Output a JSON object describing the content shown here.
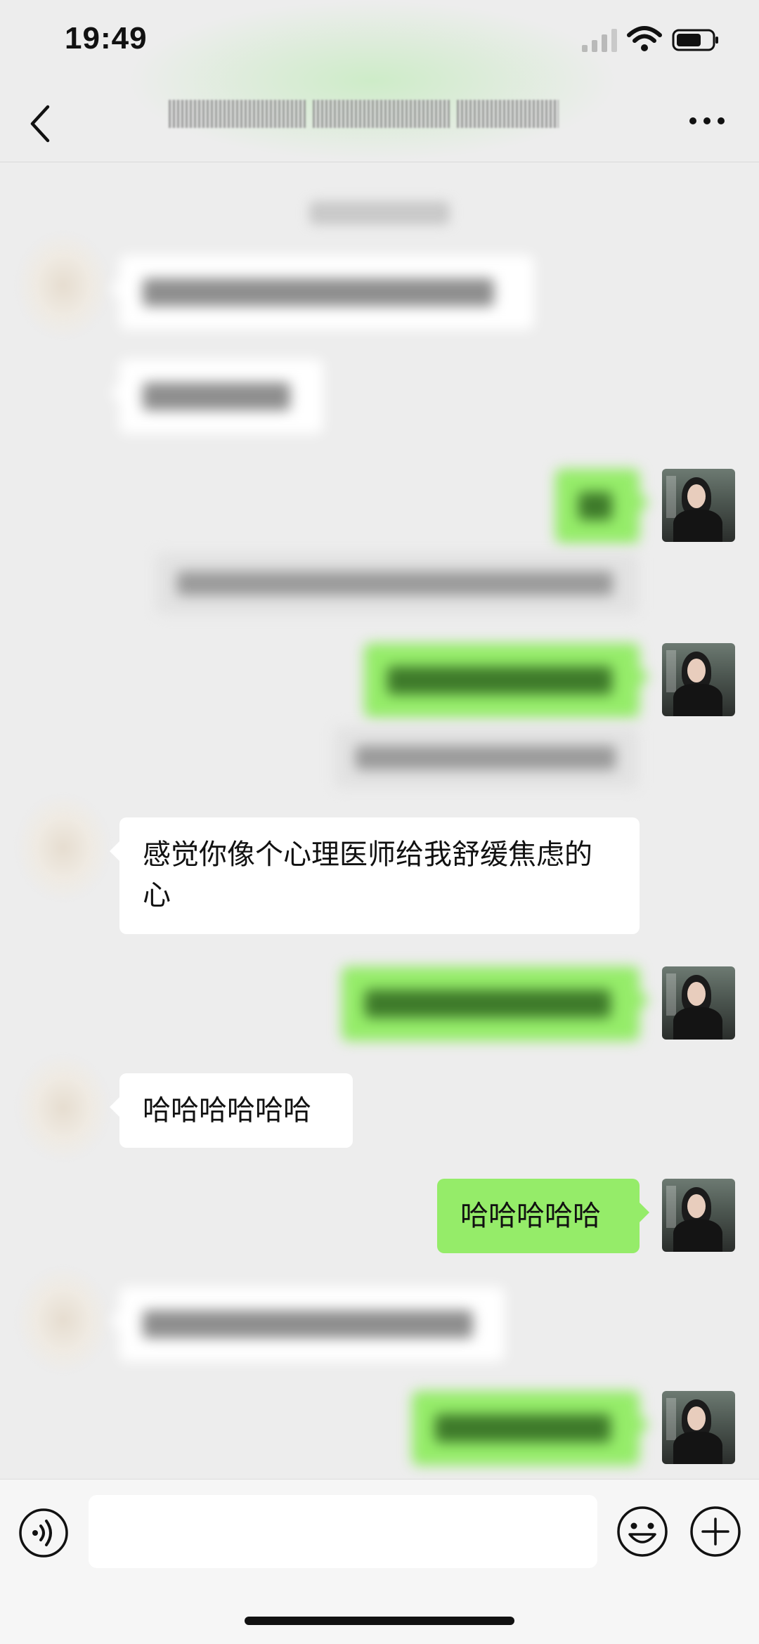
{
  "status_bar": {
    "time": "19:49"
  },
  "nav": {
    "title": "",
    "back_icon": "chevron-left-icon",
    "more_icon": "ellipsis-icon"
  },
  "messages": [
    {
      "side": "in",
      "blurred": true,
      "text": ""
    },
    {
      "side": "in",
      "blurred": true,
      "text": ""
    },
    {
      "side": "out",
      "blurred": true,
      "text": ""
    },
    {
      "side": "quote",
      "blurred": true,
      "text": ""
    },
    {
      "side": "out",
      "blurred": true,
      "text": ""
    },
    {
      "side": "quote",
      "blurred": true,
      "text": ""
    },
    {
      "side": "in",
      "blurred": false,
      "text": "感觉你像个心理医师给我舒缓焦虑的心"
    },
    {
      "side": "out",
      "blurred": true,
      "text": ""
    },
    {
      "side": "in",
      "blurred": false,
      "text": "哈哈哈哈哈哈"
    },
    {
      "side": "out",
      "blurred": false,
      "text": "哈哈哈哈哈"
    },
    {
      "side": "in",
      "blurred": true,
      "text": ""
    },
    {
      "side": "out",
      "blurred": true,
      "text": ""
    }
  ],
  "input_bar": {
    "placeholder": "",
    "voice_icon": "voice-icon",
    "emoji_icon": "emoji-icon",
    "plus_icon": "plus-icon"
  },
  "colors": {
    "background": "#ededed",
    "outgoing_bubble": "#95ec69",
    "incoming_bubble": "#ffffff"
  }
}
